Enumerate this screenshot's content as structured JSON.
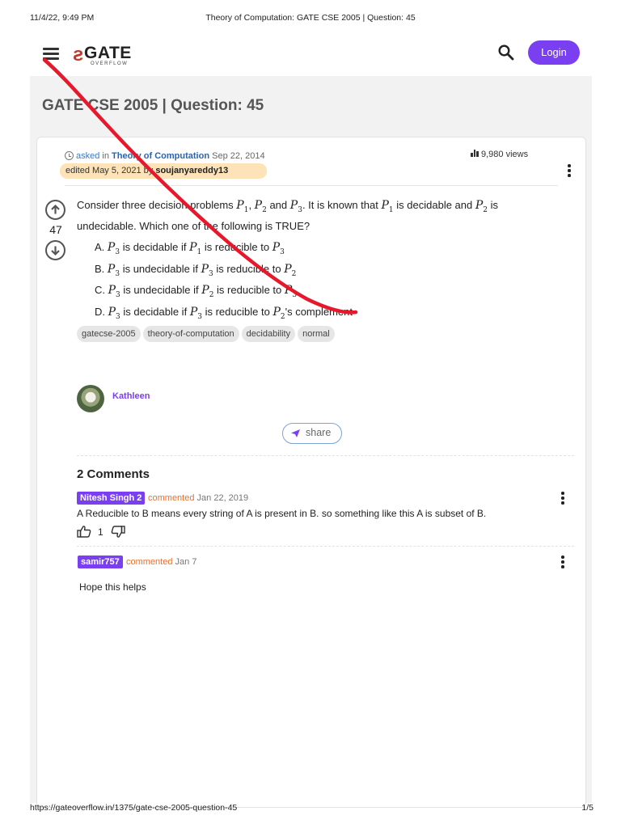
{
  "print": {
    "datetime": "11/4/22, 9:49 PM",
    "title": "Theory of Computation: GATE CSE 2005 | Question: 45",
    "url": "https://gateoverflow.in/1375/gate-cse-2005-question-45",
    "page": "1/5"
  },
  "header": {
    "logo_mark": "ƨ",
    "logo_word": "GATE",
    "logo_sub": "OVERFLOW",
    "login_label": "Login",
    "brand_color": "#7b3ff2"
  },
  "page_title": "GATE CSE 2005 | Question: 45",
  "question": {
    "asked_label": "asked",
    "in_label": "in",
    "category": "Theory of Computation",
    "asked_date": "Sep 22, 2014",
    "views": "9,980",
    "views_label": "views",
    "edited_label": "edited May 5, 2021",
    "edited_by": "by",
    "editor": "soujanyareddy13",
    "votes": "47",
    "text_1": "Consider three decision problems",
    "text_2": "and",
    "text_3": ". It is known that",
    "text_4": "is decidable and",
    "text_5": "is undecidable. Which one of the following is TRUE?",
    "p_sym": "P",
    "sub1": "1",
    "sub2": "2",
    "sub3": "3",
    "options": {
      "a_label": "A.",
      "a_1": "is decidable if",
      "a_2": "is reducible to",
      "b_label": "B.",
      "b_1": "is undecidable if",
      "b_2": "is reducible to",
      "c_label": "C.",
      "c_1": "is undecidable if",
      "c_2": "is reducible to",
      "d_label": "D.",
      "d_1": "is decidable if",
      "d_2": "is reducible to",
      "d_3": "'s complement"
    },
    "tags": [
      "gatecse-2005",
      "theory-of-computation",
      "decidability",
      "normal"
    ],
    "author": "Kathleen",
    "share_label": "share"
  },
  "comments": {
    "title": "2 Comments",
    "items": [
      {
        "user": "Nitesh Singh 2",
        "verb": "commented",
        "date": "Jan 22, 2019",
        "text": "A Reducible to B  means every string of A is present in B. so something like this A is subset of B.",
        "likes": "1"
      },
      {
        "user": "samir757",
        "verb": "commented",
        "date": "Jan 7",
        "text": "Hope this helps"
      }
    ]
  },
  "annotation_color": "#e8182c"
}
